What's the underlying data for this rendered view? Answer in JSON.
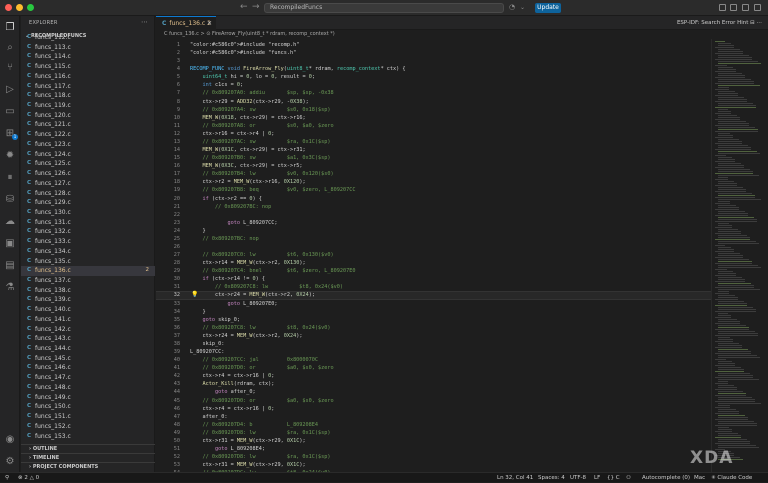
{
  "window": {
    "title": "RecompiledFuncs",
    "update_label": "Update"
  },
  "activity": {
    "icons": [
      "files-icon",
      "search-icon",
      "source-control-icon",
      "run-debug-icon",
      "remote-explorer-icon",
      "extensions-icon",
      "esp-idf-icon",
      "pause-icon",
      "database-icon",
      "cloud-icon",
      "box-icon",
      "terminal-icon",
      "test-icon",
      "account-icon",
      "settings-icon"
    ],
    "badge": "1"
  },
  "sidebar": {
    "title": "EXPLORER",
    "root": "RECOMPILEDFUNCS",
    "files": [
      "funcs_112.c",
      "funcs_113.c",
      "funcs_114.c",
      "funcs_115.c",
      "funcs_116.c",
      "funcs_117.c",
      "funcs_118.c",
      "funcs_119.c",
      "funcs_120.c",
      "funcs_121.c",
      "funcs_122.c",
      "funcs_123.c",
      "funcs_124.c",
      "funcs_125.c",
      "funcs_126.c",
      "funcs_127.c",
      "funcs_128.c",
      "funcs_129.c",
      "funcs_130.c",
      "funcs_131.c",
      "funcs_132.c",
      "funcs_133.c",
      "funcs_134.c",
      "funcs_135.c",
      "funcs_136.c",
      "funcs_137.c",
      "funcs_138.c",
      "funcs_139.c",
      "funcs_140.c",
      "funcs_141.c",
      "funcs_142.c",
      "funcs_143.c",
      "funcs_144.c",
      "funcs_145.c",
      "funcs_146.c",
      "funcs_147.c",
      "funcs_148.c",
      "funcs_149.c",
      "funcs_150.c",
      "funcs_151.c",
      "funcs_152.c",
      "funcs_153.c"
    ],
    "file_icon": "C",
    "selected_index": 24,
    "selected_badge": "2",
    "sections": [
      "OUTLINE",
      "TIMELINE",
      "PROJECT COMPONENTS"
    ]
  },
  "tab": {
    "icon": "C",
    "label": "funcs_136.c",
    "badge": "2",
    "close": "✕"
  },
  "hint": "ESP-IDF: Search Error Hint",
  "breadcrumb": "C funcs_136.c  >  ⊙ FireArrow_Fly(uint8_t * rdram, recomp_context *)",
  "editor": {
    "current_line": 32,
    "lines": [
      "#include \"recomp.h\"",
      "#include \"funcs.h\"",
      "",
      "RECOMP_FUNC void FireArrow_Fly(uint8_t* rdram, recomp_context* ctx) {",
      "    uint64_t hi = 0, lo = 0, result = 0;",
      "    int c1cs = 0;",
      "    // 0x809207A0: addiu       $sp, $sp, -0x38",
      "    ctx->r29 = ADD32(ctx->r29, -0X38);",
      "    // 0x809207A4: sw          $s0, 0x18($sp)",
      "    MEM_W(0X18, ctx->r29) = ctx->r16;",
      "    // 0x809207A8: or          $s0, $a0, $zero",
      "    ctx->r16 = ctx->r4 | 0;",
      "    // 0x809207AC: sw          $ra, 0x1C($sp)",
      "    MEM_W(0X1C, ctx->r29) = ctx->r31;",
      "    // 0x809207B0: sw          $a1, 0x3C($sp)",
      "    MEM_W(0X3C, ctx->r29) = ctx->r5;",
      "    // 0x809207B4: lw          $v0, 0x120($s0)",
      "    ctx->r2 = MEM_W(ctx->r16, 0X120);",
      "    // 0x809207B8: beq         $v0, $zero, L_809207CC",
      "    if (ctx->r2 == 0) {",
      "        // 0x809207BC: nop",
      "",
      "            goto L_809207CC;",
      "    }",
      "    // 0x809207BC: nop",
      "",
      "    // 0x809207C0: lw          $t6, 0x130($v0)",
      "    ctx->r14 = MEM_W(ctx->r2, 0X130);",
      "    // 0x809207C4: bnel        $t6, $zero, L_809207E0",
      "    if (ctx->r14 != 0) {",
      "        // 0x809207C8: lw          $t8, 0x24($v0)",
      "        ctx->r24 = MEM_W(ctx->r2, 0X24);",
      "            goto L_809207E0;",
      "    }",
      "    goto skip_0;",
      "    // 0x809207C8: lw          $t8, 0x24($v0)",
      "    ctx->r24 = MEM_W(ctx->r2, 0X24);",
      "    skip_0:",
      "L_809207CC:",
      "    // 0x809207CC: jal         0x8000070C",
      "    // 0x809207D0: or          $a0, $s0, $zero",
      "    ctx->r4 = ctx->r16 | 0;",
      "    Actor_Kill(rdram, ctx);",
      "        goto after_0;",
      "    // 0x809207D0: or          $a0, $s0, $zero",
      "    ctx->r4 = ctx->r16 | 0;",
      "    after_0:",
      "    // 0x809207D4: b           L_809208E4",
      "    // 0x809207D8: lw          $ra, 0x1C($sp)",
      "    ctx->r31 = MEM_W(ctx->r29, 0X1C);",
      "        goto L_809208E4;",
      "    // 0x809207D8: lw          $ra, 0x1C($sp)",
      "    ctx->r31 = MEM_W(ctx->r29, 0X1C);",
      "    // 0x809207DC: lw          $t8, 0x24($v0)"
    ]
  },
  "status": {
    "left": [
      "⊗ 2 △ 0"
    ],
    "position": "Ln 32, Col 41",
    "spaces": "Spaces: 4",
    "encoding": "UTF-8",
    "eol": "LF",
    "lang": "{} C",
    "autocomplete": "Autocomplete (0)",
    "platform": "Mac",
    "claude": "✳ Claude Code"
  },
  "watermark": "XDA",
  "colors": {
    "keyword": "#569cd6",
    "type": "#4ec9b0",
    "func": "#dcdcaa",
    "comment": "#6a9955",
    "string": "#ce9178",
    "number": "#b5cea8",
    "control": "#c586c0",
    "macro": "#4fc1ff",
    "accent": "#0e7ad1"
  }
}
